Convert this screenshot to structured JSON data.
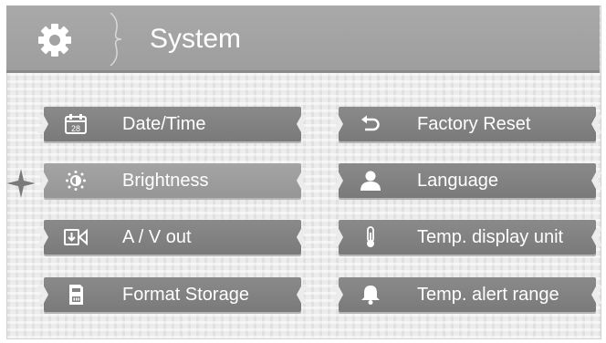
{
  "header": {
    "title": "System",
    "icon": "gear-icon"
  },
  "menu": {
    "left": [
      {
        "label": "Date/Time",
        "icon": "calendar-icon",
        "calendar_day": "28"
      },
      {
        "label": "Brightness",
        "icon": "brightness-icon",
        "selected": true
      },
      {
        "label": "A / V out",
        "icon": "av-out-icon"
      },
      {
        "label": "Format Storage",
        "icon": "storage-icon"
      }
    ],
    "right": [
      {
        "label": "Factory Reset",
        "icon": "reset-icon"
      },
      {
        "label": "Language",
        "icon": "user-icon"
      },
      {
        "label": "Temp. display unit",
        "icon": "thermometer-icon"
      },
      {
        "label": "Temp. alert range",
        "icon": "bell-icon"
      }
    ]
  },
  "colors": {
    "header": "#a3a3a3",
    "button": "#828282",
    "button_selected": "#9d9d9d",
    "text": "#ffffff"
  }
}
